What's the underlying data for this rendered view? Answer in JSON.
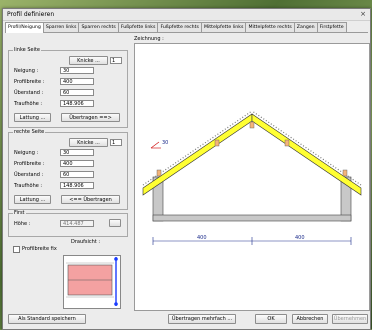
{
  "window": {
    "title": "Profil definieren",
    "close": "×"
  },
  "tabs": [
    "Profil/Neigung",
    "Sparren links",
    "Sparren rechts",
    "Fußpfette links",
    "Fußpfette rechts",
    "Mittelpfette links",
    "Mittelpfette rechts",
    "Zangen",
    "Firstpfette"
  ],
  "zeichnung_label": "Zeichnung :",
  "left": {
    "title": "linke Seite",
    "knicke_label": "Knicke ...",
    "knicke_count": "1",
    "neigung_label": "Neigung :",
    "neigung": "30",
    "profilbreite_label": "Profilbreite :",
    "profilbreite": "400",
    "ueberstand_label": "Überstand :",
    "ueberstand": "60",
    "traufhoehe_label": "Traufhöhe :",
    "traufhoehe": "148.906",
    "lattung_label": "Lattung ...",
    "uebertragen_label": "Übertragen ==>"
  },
  "right": {
    "title": "rechte Seite",
    "knicke_label": "Knicke ...",
    "knicke_count": "1",
    "neigung_label": "Neigung :",
    "neigung": "30",
    "profilbreite_label": "Profilbreite :",
    "profilbreite": "400",
    "ueberstand_label": "Überstand :",
    "ueberstand": "60",
    "traufhoehe_label": "Traufhöhe :",
    "traufhoehe": "148.906",
    "lattung_label": "Lattung ...",
    "uebertragen_label": "<== Übertragen"
  },
  "first": {
    "title": "First",
    "hoehe_label": "Höhe :",
    "hoehe": "414.487"
  },
  "profilbreite_fix_label": "Profilbreite fix",
  "draufsicht_label": "Draufsicht :",
  "drawing": {
    "angle_label": "30",
    "dim_left": "400",
    "dim_right": "400"
  },
  "footer": {
    "standard": "Als Standard speichern",
    "mehrfach": "Übertragen mehrfach ...",
    "ok": "OK",
    "abbrechen": "Abbrechen",
    "uebernehmen": "Übernehmen"
  }
}
